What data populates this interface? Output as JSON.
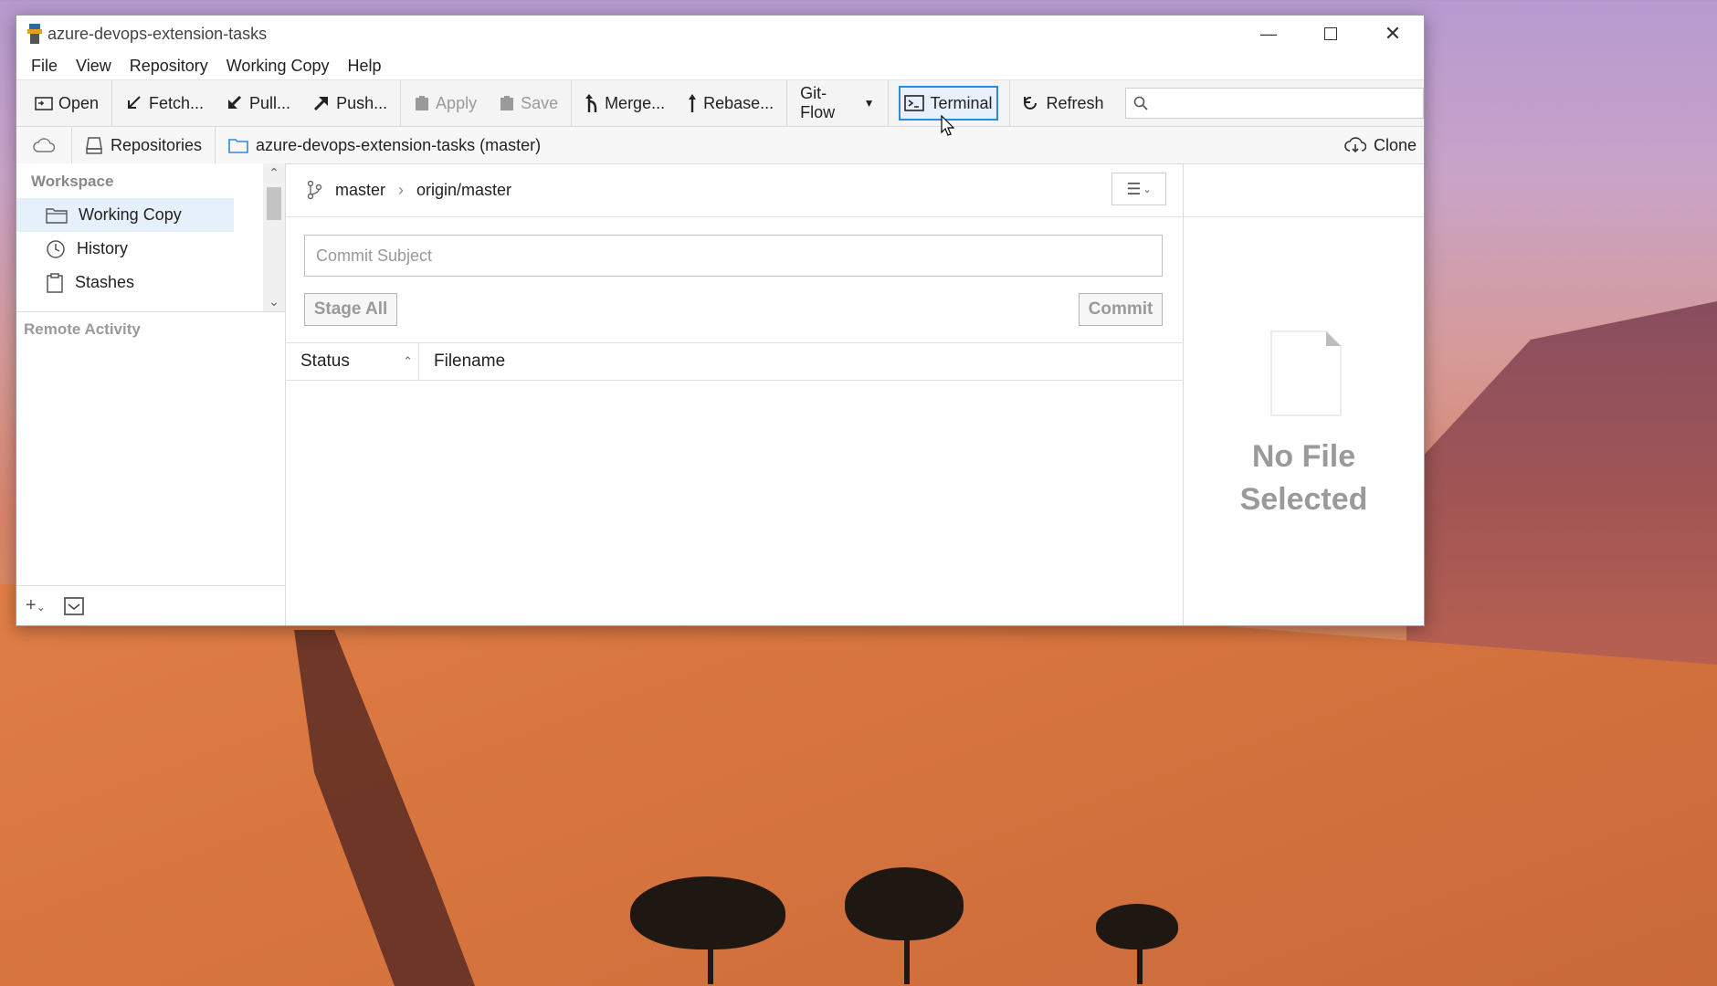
{
  "window": {
    "title": "azure-devops-extension-tasks"
  },
  "menu": [
    "File",
    "View",
    "Repository",
    "Working Copy",
    "Help"
  ],
  "toolbar": {
    "open": "Open",
    "fetch": "Fetch...",
    "pull": "Pull...",
    "push": "Push...",
    "apply": "Apply",
    "save": "Save",
    "merge": "Merge...",
    "rebase": "Rebase...",
    "gitflow": "Git-Flow",
    "terminal": "Terminal",
    "refresh": "Refresh",
    "search_placeholder": ""
  },
  "pathbar": {
    "repositories": "Repositories",
    "repo": "azure-devops-extension-tasks (master)",
    "clone": "Clone"
  },
  "sidebar": {
    "workspace_header": "Workspace",
    "items": [
      {
        "label": "Working Copy",
        "icon": "folder-icon"
      },
      {
        "label": "History",
        "icon": "clock-icon"
      },
      {
        "label": "Stashes",
        "icon": "clipboard-icon"
      }
    ],
    "remote_header": "Remote Activity"
  },
  "branch": {
    "local": "master",
    "remote": "origin/master"
  },
  "commit": {
    "subject_placeholder": "Commit Subject",
    "stage_all": "Stage All",
    "commit": "Commit"
  },
  "table": {
    "columns": [
      "Status",
      "Filename"
    ]
  },
  "preview": {
    "line1": "No File",
    "line2": "Selected"
  },
  "colors": {
    "accent": "#2e8ad8",
    "selected_bg": "#e6f0fb",
    "muted_text": "#9a9a9a"
  }
}
